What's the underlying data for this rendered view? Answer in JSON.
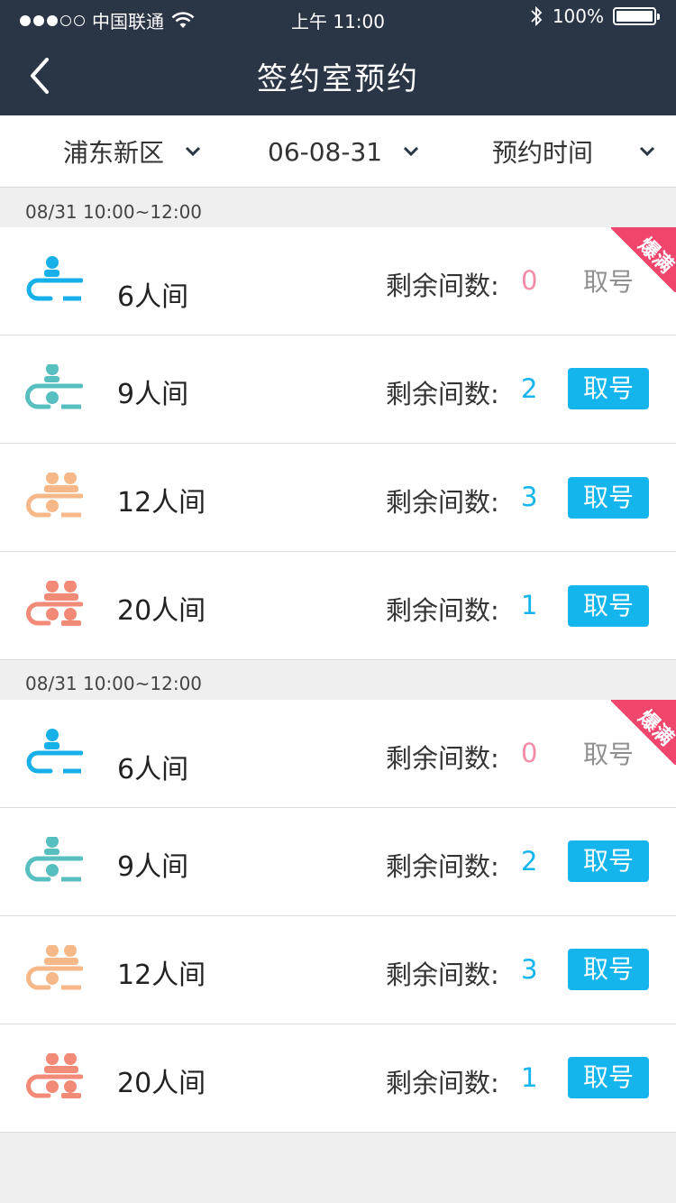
{
  "status": {
    "carrier": "中国联通",
    "time": "上午 11:00",
    "battery": "100%"
  },
  "header": {
    "title": "签约室预约"
  },
  "filters": [
    {
      "label": "浦东新区"
    },
    {
      "label": "06-08-31"
    },
    {
      "label": "预约时间"
    }
  ],
  "sections": [
    {
      "slot": "08/31 10:00~12:00",
      "rooms": [
        {
          "name": "6人间",
          "remain_label": "剩余间数:",
          "remain": "0",
          "action": "取号",
          "full": true,
          "badge": "爆满"
        },
        {
          "name": "9人间",
          "remain_label": "剩余间数:",
          "remain": "2",
          "action": "取号",
          "full": false
        },
        {
          "name": "12人间",
          "remain_label": "剩余间数:",
          "remain": "3",
          "action": "取号",
          "full": false
        },
        {
          "name": "20人间",
          "remain_label": "剩余间数:",
          "remain": "1",
          "action": "取号",
          "full": false
        }
      ]
    },
    {
      "slot": "08/31 10:00~12:00",
      "rooms": [
        {
          "name": "6人间",
          "remain_label": "剩余间数:",
          "remain": "0",
          "action": "取号",
          "full": true,
          "badge": "爆满"
        },
        {
          "name": "9人间",
          "remain_label": "剩余间数:",
          "remain": "2",
          "action": "取号",
          "full": false
        },
        {
          "name": "12人间",
          "remain_label": "剩余间数:",
          "remain": "3",
          "action": "取号",
          "full": false
        },
        {
          "name": "20人间",
          "remain_label": "剩余间数:",
          "remain": "1",
          "action": "取号",
          "full": false
        }
      ]
    }
  ],
  "colors": {
    "header_bg": "#2a3545",
    "accent": "#14b4ec",
    "full_badge": "#f0466e",
    "zero_count": "#f38aa6",
    "icon_6": "#18b0e8",
    "icon_9": "#58bfc1",
    "icon_12": "#f6b889",
    "icon_20": "#f28a78"
  }
}
